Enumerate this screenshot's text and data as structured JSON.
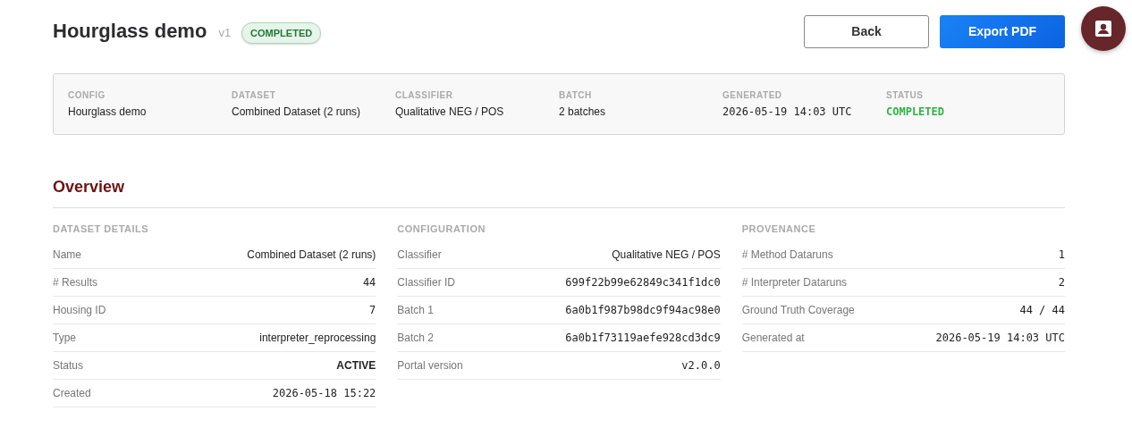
{
  "header": {
    "title": "Hourglass demo",
    "version": "v1",
    "badge": {
      "label": "COMPLETED",
      "kind": "success"
    },
    "buttons": [
      {
        "label": "Back",
        "kind": "secondary"
      },
      {
        "label": "Export PDF",
        "kind": "primary"
      }
    ]
  },
  "summary": [
    {
      "label": "CONFIG",
      "value": "Hourglass demo",
      "kind": "text"
    },
    {
      "label": "DATASET",
      "value": "Combined Dataset (2 runs)",
      "kind": "text"
    },
    {
      "label": "CLASSIFIER",
      "value": "Qualitative NEG / POS",
      "kind": "text"
    },
    {
      "label": "BATCH",
      "value": "2 batches",
      "kind": "text"
    },
    {
      "label": "GENERATED",
      "value": "2026-05-19 14:03 UTC",
      "kind": "mono"
    },
    {
      "label": "STATUS",
      "value": "COMPLETED",
      "kind": "status"
    }
  ],
  "overview": {
    "title": "Overview",
    "sections": [
      {
        "title": "DATASET DETAILS",
        "rows": [
          {
            "label": "Name",
            "value": "Combined Dataset (2 runs)",
            "kind": "text"
          },
          {
            "label": "# Results",
            "value": "44",
            "kind": "mono"
          },
          {
            "label": "Housing ID",
            "value": "7",
            "kind": "mono"
          },
          {
            "label": "Type",
            "value": "interpreter_reprocessing",
            "kind": "text"
          },
          {
            "label": "Status",
            "value": "ACTIVE",
            "kind": "strong"
          },
          {
            "label": "Created",
            "value": "2026-05-18 15:22",
            "kind": "mono"
          }
        ]
      },
      {
        "title": "CONFIGURATION",
        "rows": [
          {
            "label": "Classifier",
            "value": "Qualitative NEG / POS",
            "kind": "text"
          },
          {
            "label": "Classifier ID",
            "value": "699f22b99e62849c341f1dc0",
            "kind": "mono"
          },
          {
            "label": "Batch 1",
            "value": "6a0b1f987b98dc9f94ac98e0",
            "kind": "mono"
          },
          {
            "label": "Batch 2",
            "value": "6a0b1f73119aefe928cd3dc9",
            "kind": "mono"
          },
          {
            "label": "Portal version",
            "value": "v2.0.0",
            "kind": "mono"
          }
        ]
      },
      {
        "title": "PROVENANCE",
        "rows": [
          {
            "label": "# Method Dataruns",
            "value": "1",
            "kind": "mono"
          },
          {
            "label": "# Interpreter Dataruns",
            "value": "2",
            "kind": "mono"
          },
          {
            "label": "Ground Truth Coverage",
            "value": "44 / 44",
            "kind": "mono"
          },
          {
            "label": "Generated at",
            "value": "2026-05-19 14:03 UTC",
            "kind": "mono"
          }
        ]
      }
    ]
  }
}
